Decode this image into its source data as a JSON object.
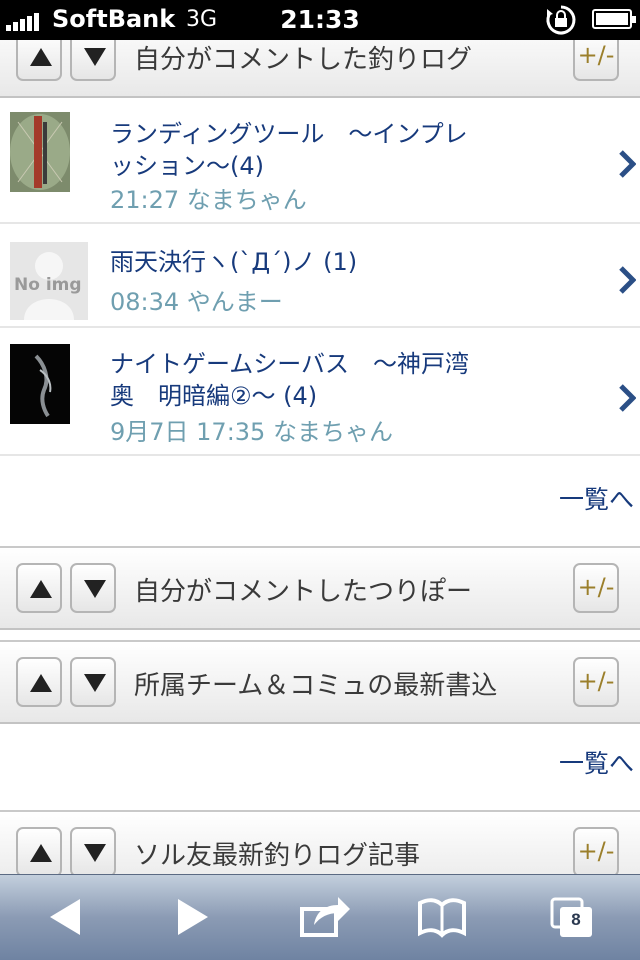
{
  "status_bar": {
    "carrier": "SoftBank",
    "network": "3G",
    "time": "21:33"
  },
  "sections": [
    {
      "title": "自分がコメントした釣りログ",
      "toggle_label": "+/-"
    },
    {
      "title": "自分がコメントしたつりぽー",
      "toggle_label": "+/-"
    },
    {
      "title": "所属チーム＆コミュの最新書込",
      "toggle_label": "+/-"
    },
    {
      "title": "ソル友最新釣りログ記事",
      "toggle_label": "+/-"
    }
  ],
  "logs": [
    {
      "title": "ランディングツール　～インプレッション～(4)",
      "meta": "21:27 なまちゃん",
      "thumb": "photo"
    },
    {
      "title": "雨天決行ヽ(`Д´)ノ (1)",
      "meta": "08:34 やんまー",
      "thumb": "no-img",
      "thumb_text": "No img"
    },
    {
      "title": "ナイトゲームシーバス　～神戸湾奥　明暗編②～ (4)",
      "meta": "9月7日 17:35 なまちゃん",
      "thumb": "photo-dark"
    }
  ],
  "more_links": [
    "一覧へ",
    "一覧へ"
  ],
  "toolbar": {
    "tab_count": "8"
  },
  "colors": {
    "link": "#173a7c",
    "meta": "#6f9fb0",
    "toggle": "#9b7f2b",
    "toolbar": "#8b9bb4"
  }
}
